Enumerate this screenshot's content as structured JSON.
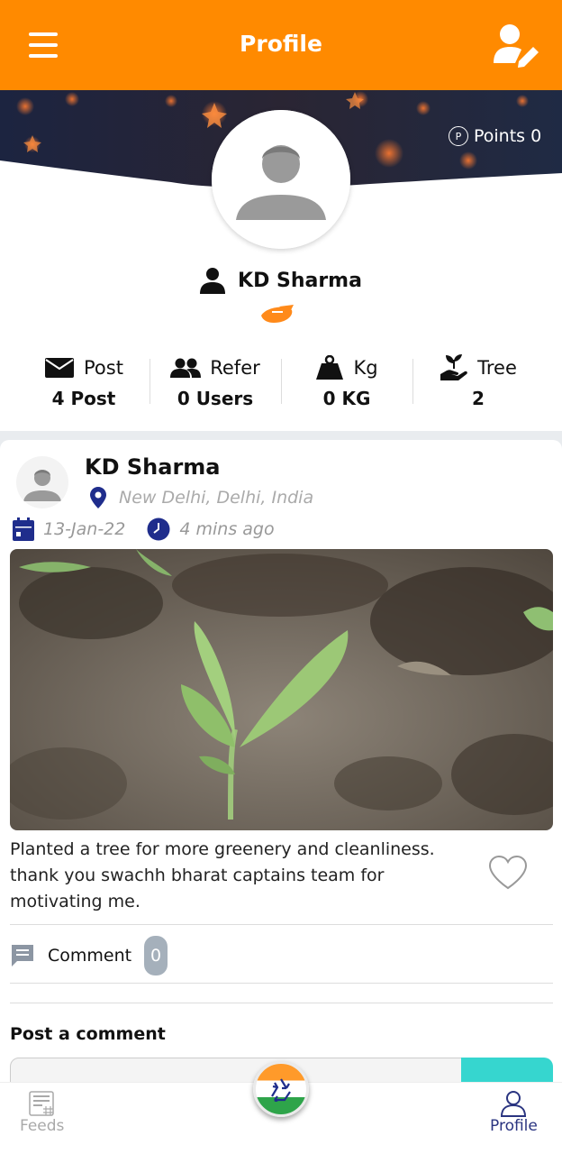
{
  "header": {
    "title": "Profile",
    "menu_icon": "menu-icon",
    "edit_icon": "edit-profile-icon"
  },
  "profile": {
    "points_label": "Points 0",
    "points_icon_text": "P",
    "name": "KD Sharma",
    "stats": [
      {
        "icon": "mail-icon",
        "label": "Post",
        "value": "4 Post"
      },
      {
        "icon": "users-icon",
        "label": "Refer",
        "value": "0 Users"
      },
      {
        "icon": "weight-icon",
        "label": "Kg",
        "value": "0 KG"
      },
      {
        "icon": "plant-hand-icon",
        "label": "Tree",
        "value": "2"
      }
    ]
  },
  "post": {
    "author": "KD Sharma",
    "location": "New Delhi, Delhi, India",
    "date": "13-Jan-22",
    "time_ago": "4 mins ago",
    "caption": "Planted a tree for more greenery and cleanliness. thank you swachh bharat captains team for motivating me.",
    "comment_label": "Comment",
    "comment_count": "0",
    "post_comment_label": "Post a comment",
    "comment_placeholder": ""
  },
  "bottom_nav": {
    "feeds_label": "Feeds",
    "profile_label": "Profile"
  },
  "colors": {
    "primary": "#ff8a00",
    "navy": "#2a3480",
    "teal": "#36d6cf"
  }
}
